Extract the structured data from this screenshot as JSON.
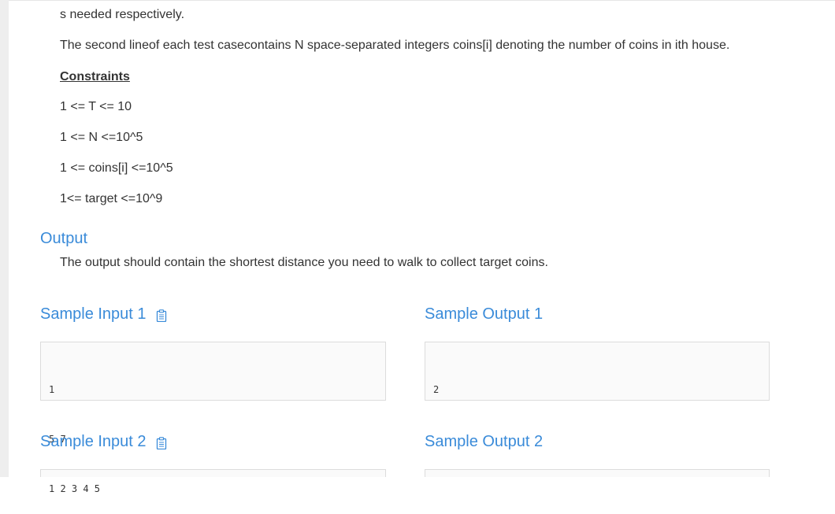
{
  "description": {
    "cut_line": "s needed respectively.",
    "second_line": "The second lineof each test casecontains N space-separated integers coins[i] denoting the number of coins in ith house."
  },
  "constraints": {
    "heading": "Constraints",
    "items": [
      "1 <= T <= 10",
      "1 <= N <=10^5",
      "1 <= coins[i] <=10^5",
      "1<= target <=10^9"
    ]
  },
  "output": {
    "title": "Output",
    "text": "The output should contain the shortest distance you need to walk to collect target coins."
  },
  "samples": {
    "input1": {
      "title": "Sample Input 1",
      "lines": [
        "1",
        "5 7",
        "1 2 3 4 5"
      ]
    },
    "output1": {
      "title": "Sample Output 1",
      "lines": [
        "2"
      ]
    },
    "input2": {
      "title": "Sample Input 2"
    },
    "output2": {
      "title": "Sample Output 2"
    }
  },
  "icons": {
    "copy": "clipboard-icon"
  },
  "colors": {
    "heading": "#3a8bd9",
    "text": "#333333"
  }
}
